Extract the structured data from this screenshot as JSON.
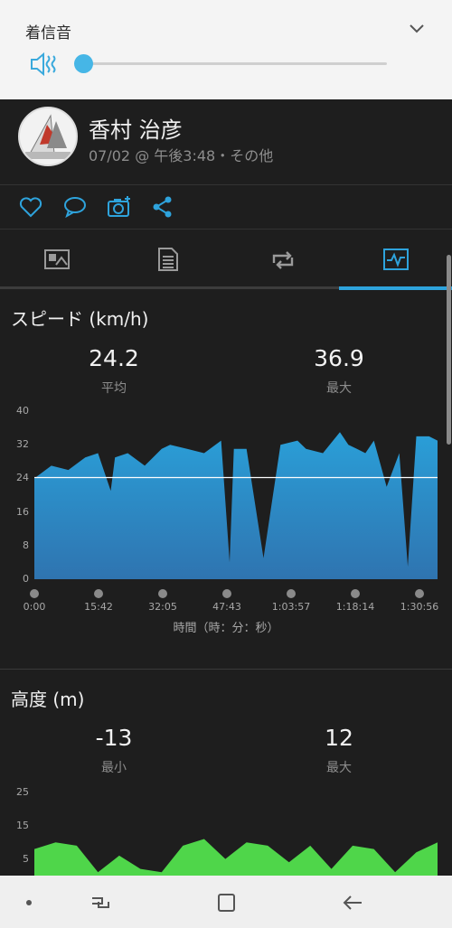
{
  "volume_panel": {
    "title": "着信音",
    "icon_speaker": "speaker-muted-icon",
    "icon_expand": "chevron-down-icon",
    "level": 0.0
  },
  "activity": {
    "user_name": "香村 治彦",
    "meta": "07/02 @ 午後3:48・その他"
  },
  "actions": [
    "heart-icon",
    "comment-icon",
    "camera-add-icon",
    "share-icon"
  ],
  "tabs": [
    {
      "icon": "overview-icon",
      "selected": false
    },
    {
      "icon": "details-list-icon",
      "selected": false
    },
    {
      "icon": "laps-icon",
      "selected": false
    },
    {
      "icon": "chart-icon",
      "selected": true
    }
  ],
  "speed": {
    "title": "スピード (km/h)",
    "stats": [
      {
        "value": "24.2",
        "label": "平均"
      },
      {
        "value": "36.9",
        "label": "最大"
      }
    ]
  },
  "altitude": {
    "title": "高度 (m)",
    "stats": [
      {
        "value": "-13",
        "label": "最小"
      },
      {
        "value": "12",
        "label": "最大"
      }
    ]
  },
  "colors": {
    "accent": "#2ea3dc",
    "speed_fill_top": "#2a9fd8",
    "speed_fill_bottom": "#2f74b0",
    "altitude_fill": "#4fd64a",
    "avg_line": "#ffffff"
  },
  "chart_data": [
    {
      "type": "area",
      "title": "スピード (km/h)",
      "xlabel": "時間（時：分：秒）",
      "ylabel": "",
      "ylim": [
        0,
        40
      ],
      "y_ticks": [
        "0",
        "8",
        "16",
        "24",
        "32",
        "40"
      ],
      "x_ticks": [
        "0:00",
        "15:42",
        "32:05",
        "47:43",
        "1:03:57",
        "1:18:14",
        "1:30:56"
      ],
      "average_line": 24.2,
      "x_minutes": [
        0,
        4,
        8,
        12,
        15,
        18,
        19,
        22,
        26,
        30,
        32,
        36,
        40,
        44,
        46,
        47,
        50,
        54,
        58,
        62,
        64,
        68,
        72,
        74,
        76,
        78,
        80,
        83,
        86,
        88,
        90,
        93,
        95
      ],
      "values": [
        24,
        27,
        26,
        29,
        30,
        21,
        29,
        30,
        27,
        31,
        32,
        31,
        30,
        33,
        4,
        31,
        31,
        5,
        32,
        33,
        31,
        30,
        35,
        32,
        31,
        30,
        33,
        22,
        30,
        3,
        34,
        34,
        33
      ],
      "grid": false
    },
    {
      "type": "area",
      "title": "高度 (m)",
      "xlabel": "",
      "ylabel": "",
      "ylim": [
        0,
        25
      ],
      "y_ticks": [
        "5",
        "15",
        "25"
      ],
      "x_minutes": [
        0,
        5,
        10,
        15,
        20,
        25,
        30,
        35,
        40,
        45,
        50,
        55,
        60,
        65,
        70,
        75,
        80,
        85,
        90,
        95
      ],
      "values": [
        8,
        10,
        9,
        1,
        6,
        2,
        1,
        9,
        11,
        5,
        10,
        9,
        4,
        9,
        2,
        9,
        8,
        1,
        7,
        10
      ],
      "grid": false
    }
  ]
}
